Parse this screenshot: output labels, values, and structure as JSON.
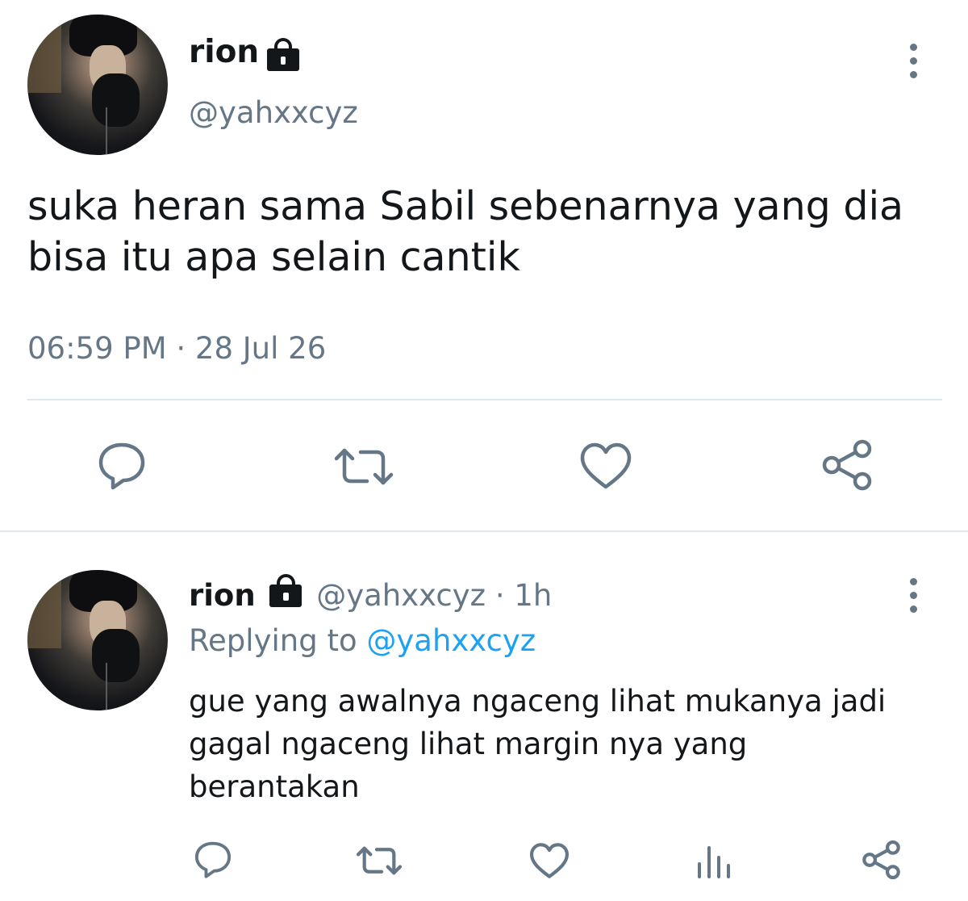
{
  "tweet": {
    "display_name": "rion",
    "handle": "@yahxxcyz",
    "text": "suka heran sama Sabil sebenarnya yang dia bisa itu apa selain cantik",
    "time": "06:59 PM",
    "separator": "·",
    "date": "28 Jul 26",
    "icons": {
      "lock": "lock-icon",
      "menu": "more-vertical-icon",
      "reply": "reply-icon",
      "retweet": "retweet-icon",
      "like": "heart-icon",
      "share": "share-icon"
    }
  },
  "reply": {
    "display_name": "rion",
    "handle": "@yahxxcyz",
    "separator": "·",
    "age": "1h",
    "replying_prefix": "Replying to",
    "replying_handle": "@yahxxcyz",
    "text": "gue yang awalnya ngaceng lihat mukanya jadi gagal ngaceng lihat margin nya yang berantakan",
    "icons": {
      "lock": "lock-icon",
      "menu": "more-vertical-icon",
      "reply": "reply-icon",
      "retweet": "retweet-icon",
      "like": "heart-icon",
      "analytics": "analytics-icon",
      "share": "share-icon"
    }
  },
  "colors": {
    "text": "#14171a",
    "muted": "#657786",
    "link": "#1da1f2",
    "divider": "#e1e8ed"
  }
}
